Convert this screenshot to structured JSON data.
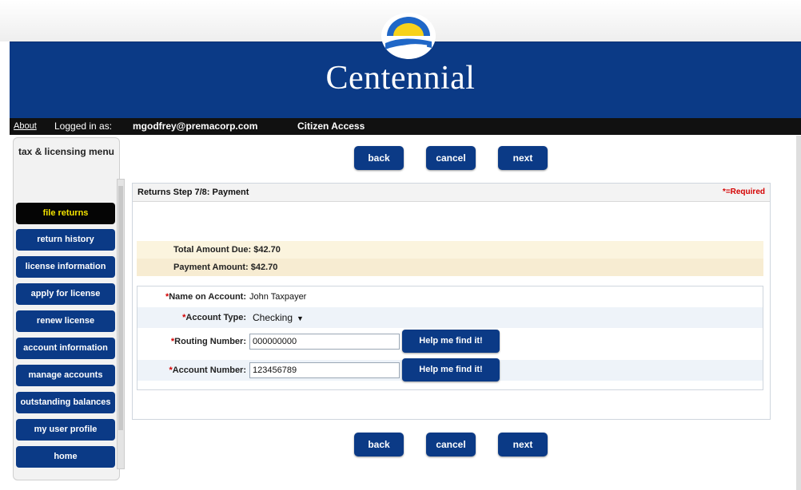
{
  "header": {
    "logo_text": "Centennial",
    "about_link": "About",
    "logged_in_label": "Logged in as:",
    "user_email": "mgodfrey@premacorp.com",
    "portal_name": "Citizen Access"
  },
  "sidebar": {
    "title": "tax & licensing menu",
    "items": [
      {
        "label": "file returns",
        "active": true
      },
      {
        "label": "return history"
      },
      {
        "label": "license information"
      },
      {
        "label": "apply for license"
      },
      {
        "label": "renew license"
      },
      {
        "label": "account information"
      },
      {
        "label": "manage accounts"
      },
      {
        "label": "outstanding balances"
      },
      {
        "label": "my user profile"
      },
      {
        "label": "home"
      }
    ]
  },
  "nav_buttons": {
    "back": "back",
    "cancel": "cancel",
    "next": "next"
  },
  "panel": {
    "title": "Returns Step 7/8: Payment",
    "required_note": "*=Required",
    "total_due": "Total Amount Due: $42.70",
    "payment_amount": "Payment Amount: $42.70"
  },
  "form": {
    "name_label": "Name on Account:",
    "name_value": "John Taxpayer",
    "account_type_label": "Account Type:",
    "account_type_value": "Checking",
    "routing_label": "Routing Number:",
    "routing_value": "000000000",
    "account_number_label": "Account Number:",
    "account_number_value": "123456789",
    "help_button": "Help me find it!"
  },
  "colors": {
    "brand_blue": "#0b3a86",
    "active_menu_bg": "#050505",
    "active_menu_text": "#f2e200",
    "required_red": "#d40000"
  }
}
